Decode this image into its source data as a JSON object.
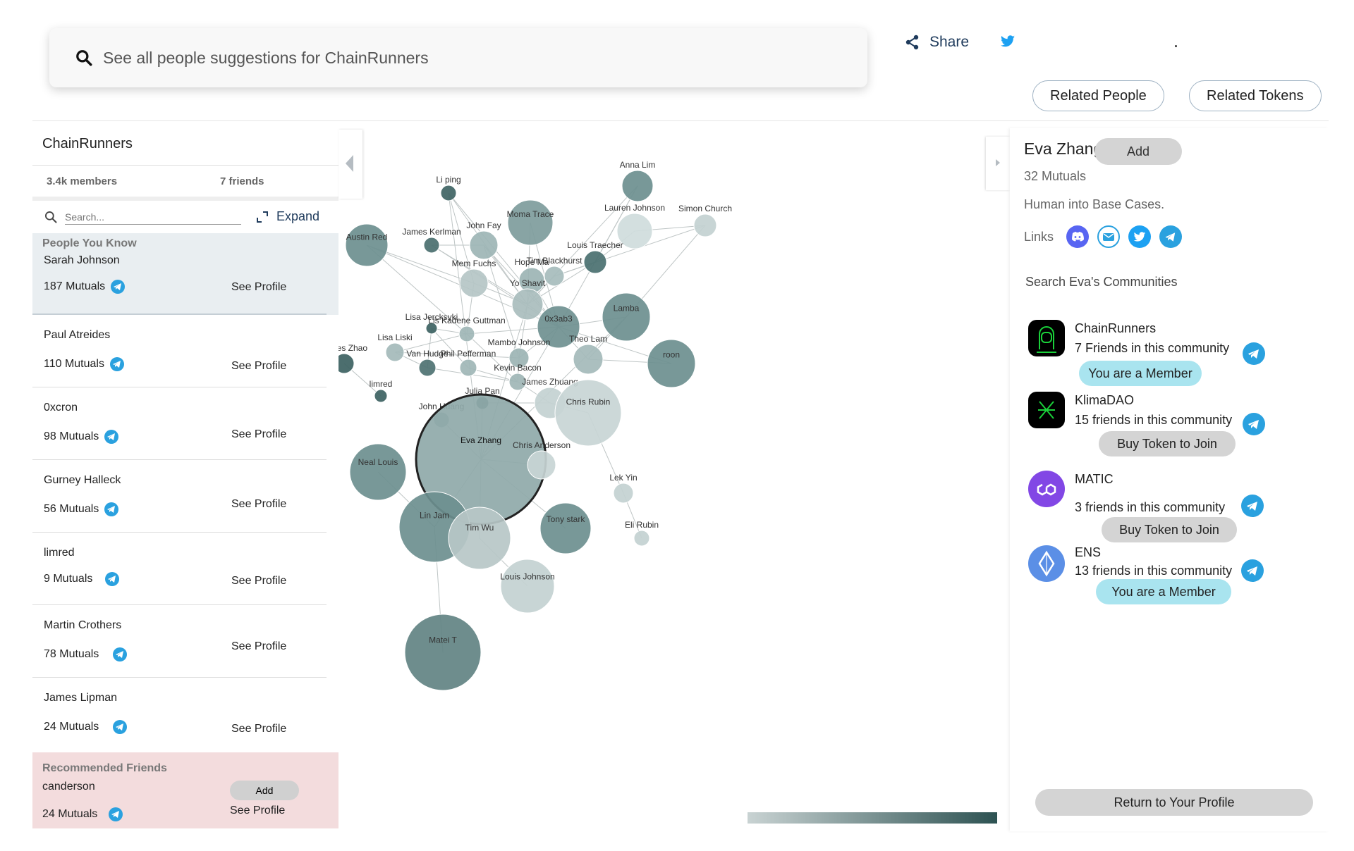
{
  "topbar": {
    "search_placeholder": "See all people suggestions for ChainRunners",
    "share_label": "Share",
    "related_people_label": "Related People",
    "related_tokens_label": "Related Tokens"
  },
  "left": {
    "community_name": "ChainRunners",
    "members": "3.4k members",
    "friends": "7 friends",
    "search_placeholder": "Search...",
    "expand_label": "Expand",
    "people_you_know_title": "People You Know",
    "people": [
      {
        "name": "Sarah Johnson",
        "mutuals": "187 Mutuals",
        "action": "See Profile"
      },
      {
        "name": "Paul Atreides",
        "mutuals": "110 Mutuals",
        "action": "See Profile"
      },
      {
        "name": "0xcron",
        "mutuals": "98 Mutuals",
        "action": "See Profile"
      },
      {
        "name": "Gurney Halleck",
        "mutuals": "56 Mutuals",
        "action": "See Profile"
      },
      {
        "name": "limred",
        "mutuals": "9 Mutuals",
        "action": "See Profile"
      },
      {
        "name": "Martin Crothers",
        "mutuals": "78 Mutuals",
        "action": "See Profile"
      },
      {
        "name": "James Lipman",
        "mutuals": "24 Mutuals",
        "action": "See Profile"
      }
    ],
    "recommended_title": "Recommended Friends",
    "recommended": {
      "name": "canderson",
      "mutuals": "24 Mutuals",
      "add_label": "Add",
      "action": "See Profile"
    }
  },
  "graph": {
    "nodes": [
      {
        "label": "Li ping"
      },
      {
        "label": "Anna Lim"
      },
      {
        "label": "Moma Trace"
      },
      {
        "label": "Simon Church"
      },
      {
        "label": "Lauren Johnson"
      },
      {
        "label": "Austin Red"
      },
      {
        "label": "James Kerlman"
      },
      {
        "label": "John Fay"
      },
      {
        "label": "Louis Traecher"
      },
      {
        "label": "Tim Blackhurst"
      },
      {
        "label": "Mem Fuchs"
      },
      {
        "label": "Hope Ma"
      },
      {
        "label": "Yo Shavit"
      },
      {
        "label": "Lamba"
      },
      {
        "label": "0x3ab3"
      },
      {
        "label": "Lisa Jercksyki"
      },
      {
        "label": "Lis Kadene Guttman"
      },
      {
        "label": "Lisa Liski"
      },
      {
        "label": "Mambo Johnson"
      },
      {
        "label": "Theo Lam"
      },
      {
        "label": "roon"
      },
      {
        "label": "James Zhao"
      },
      {
        "label": "Van Hudge"
      },
      {
        "label": "Phil Pefferman"
      },
      {
        "label": "Kevin Bacon"
      },
      {
        "label": "limred"
      },
      {
        "label": "Julia Pan"
      },
      {
        "label": "James Zhuang"
      },
      {
        "label": "Chris Rubin"
      },
      {
        "label": "John Huang"
      },
      {
        "label": "Eva Zhang"
      },
      {
        "label": "Chris Anderson"
      },
      {
        "label": "Neal Louis"
      },
      {
        "label": "Lek Yin"
      },
      {
        "label": "Lin Jam"
      },
      {
        "label": "Tim Wu"
      },
      {
        "label": "Tony stark"
      },
      {
        "label": "Eli Rubin"
      },
      {
        "label": "Louis Johnson"
      },
      {
        "label": "Matei T"
      }
    ]
  },
  "profile": {
    "name": "Eva Zhang",
    "add_label": "Add",
    "mutuals": "32 Mutuals",
    "bio": "Human into Base Cases.",
    "links_label": "Links",
    "search_communities_label": "Search Eva's Communities",
    "communities": [
      {
        "name": "ChainRunners",
        "friends": "7 Friends in this community",
        "action": "You are a Member"
      },
      {
        "name": "KlimaDAO",
        "friends": "15 friends in this community",
        "action": "Buy Token to Join"
      },
      {
        "name": "MATIC",
        "friends": "3 friends in this community",
        "action": "Buy Token to Join"
      },
      {
        "name": "ENS",
        "friends": "13 friends in this community",
        "action": "You are a Member"
      }
    ],
    "return_label": "Return to Your Profile"
  },
  "colors": {
    "accent": "#2aa1df",
    "member": "#a9e4ef",
    "node_dark": "#4a7070",
    "node_light": "#c3d1d1"
  }
}
